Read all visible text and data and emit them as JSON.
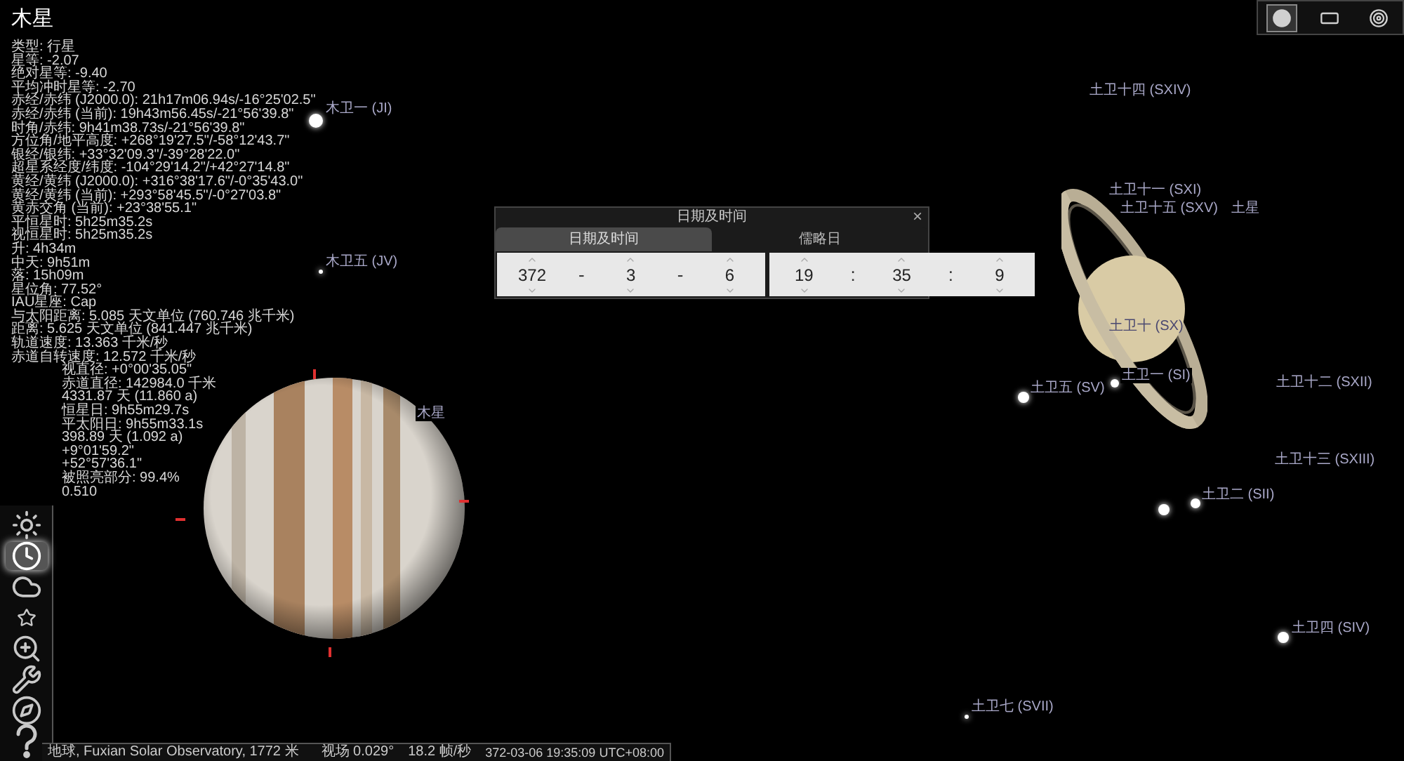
{
  "object_title": "木星",
  "info_lines": [
    "类型: 行星",
    "星等: -2.07",
    "绝对星等: -9.40",
    "平均冲时星等: -2.70",
    "赤经/赤纬 (J2000.0): 21h17m06.94s/-16°25'02.5\"",
    "赤经/赤纬 (当前): 19h43m56.45s/-21°56'39.8\"",
    "时角/赤纬: 9h41m38.73s/-21°56'39.8\"",
    "方位角/地平高度: +268°19'27.5\"/-58°12'43.7\"",
    "银经/银纬: +33°32'09.3\"/-39°28'22.0\"",
    "超星系经度/纬度: -104°29'14.2\"/+42°27'14.8\"",
    "黄经/黄纬 (J2000.0): +316°38'17.6\"/-0°35'43.0\"",
    "黄经/黄纬 (当前): +293°58'45.5\"/-0°27'03.8\"",
    "黄赤交角 (当前): +23°38'55.1\"",
    "平恒星时: 5h25m35.2s",
    "视恒星时: 5h25m35.2s",
    "升: 4h34m",
    "中天: 9h51m",
    "落: 15h09m",
    "星位角: 77.52°",
    "IAU星座: Cap",
    "与太阳距离: 5.085 天文单位 (760.746 兆千米)",
    "距离: 5.625 天文单位 (841.447 兆千米)",
    "轨道速度: 13.363 千米/秒",
    "赤道自转速度: 12.572 千米/秒"
  ],
  "info_lines_beside_toolbar": [
    "视直径: +0°00'35.05\"",
    "赤道直径: 142984.0 千米",
    "4331.87 天 (11.860 a)",
    "恒星日: 9h55m29.7s",
    "平太阳日: 9h55m33.1s",
    "398.89 天 (1.092 a)",
    "+9°01'59.2\"",
    "+52°57'36.1\"",
    "被照亮部分: 99.4%",
    "0.510"
  ],
  "toolbar": [
    {
      "kind": "brightness",
      "selected": false
    },
    {
      "kind": "clock",
      "selected": true
    },
    {
      "kind": "sky",
      "selected": false
    },
    {
      "kind": "star",
      "selected": false
    },
    {
      "kind": "search",
      "selected": false
    },
    {
      "kind": "settings",
      "selected": false
    },
    {
      "kind": "compass",
      "selected": false
    },
    {
      "kind": "help",
      "selected": false
    }
  ],
  "top_right_buttons": [
    {
      "kind": "circle",
      "selected": true
    },
    {
      "kind": "rectangle",
      "selected": false
    },
    {
      "kind": "target",
      "selected": false
    }
  ],
  "sky_labels": [
    "木卫一 (JI)",
    "木卫五 (JV)",
    "木星",
    "土卫十四 (SXIV)",
    "土卫十一 (SXI)",
    "土卫十五 (SXV)",
    "土星",
    "土卫十 (SX)",
    "土卫一 (SI)",
    "土卫五 (SV)",
    "土卫十二 (SXII)",
    "土卫十三 (SXIII)",
    "土卫二 (SII)",
    "土卫四 (SIV)",
    "土卫七 (SVII)"
  ],
  "dialog": {
    "title": "日期及时间",
    "close": "×",
    "tabs": [
      {
        "label": "日期及时间",
        "selected": true
      },
      {
        "label": "儒略日",
        "selected": false
      }
    ],
    "date_fields": [
      {
        "value": "372"
      },
      {
        "separator": "-"
      },
      {
        "value": "3"
      },
      {
        "separator": "-"
      },
      {
        "value": "6"
      }
    ],
    "time_fields": [
      {
        "value": "19"
      },
      {
        "separator": ":"
      },
      {
        "value": "35"
      },
      {
        "separator": ":"
      },
      {
        "value": "9"
      }
    ]
  },
  "status_bar": {
    "location": "地球, Fuxian Solar Observatory, 1772 米",
    "fov": "视场 0.029°",
    "fps": "18.2 帧/秒",
    "datetime": "372-03-06 19:35:09 UTC+08:00"
  }
}
